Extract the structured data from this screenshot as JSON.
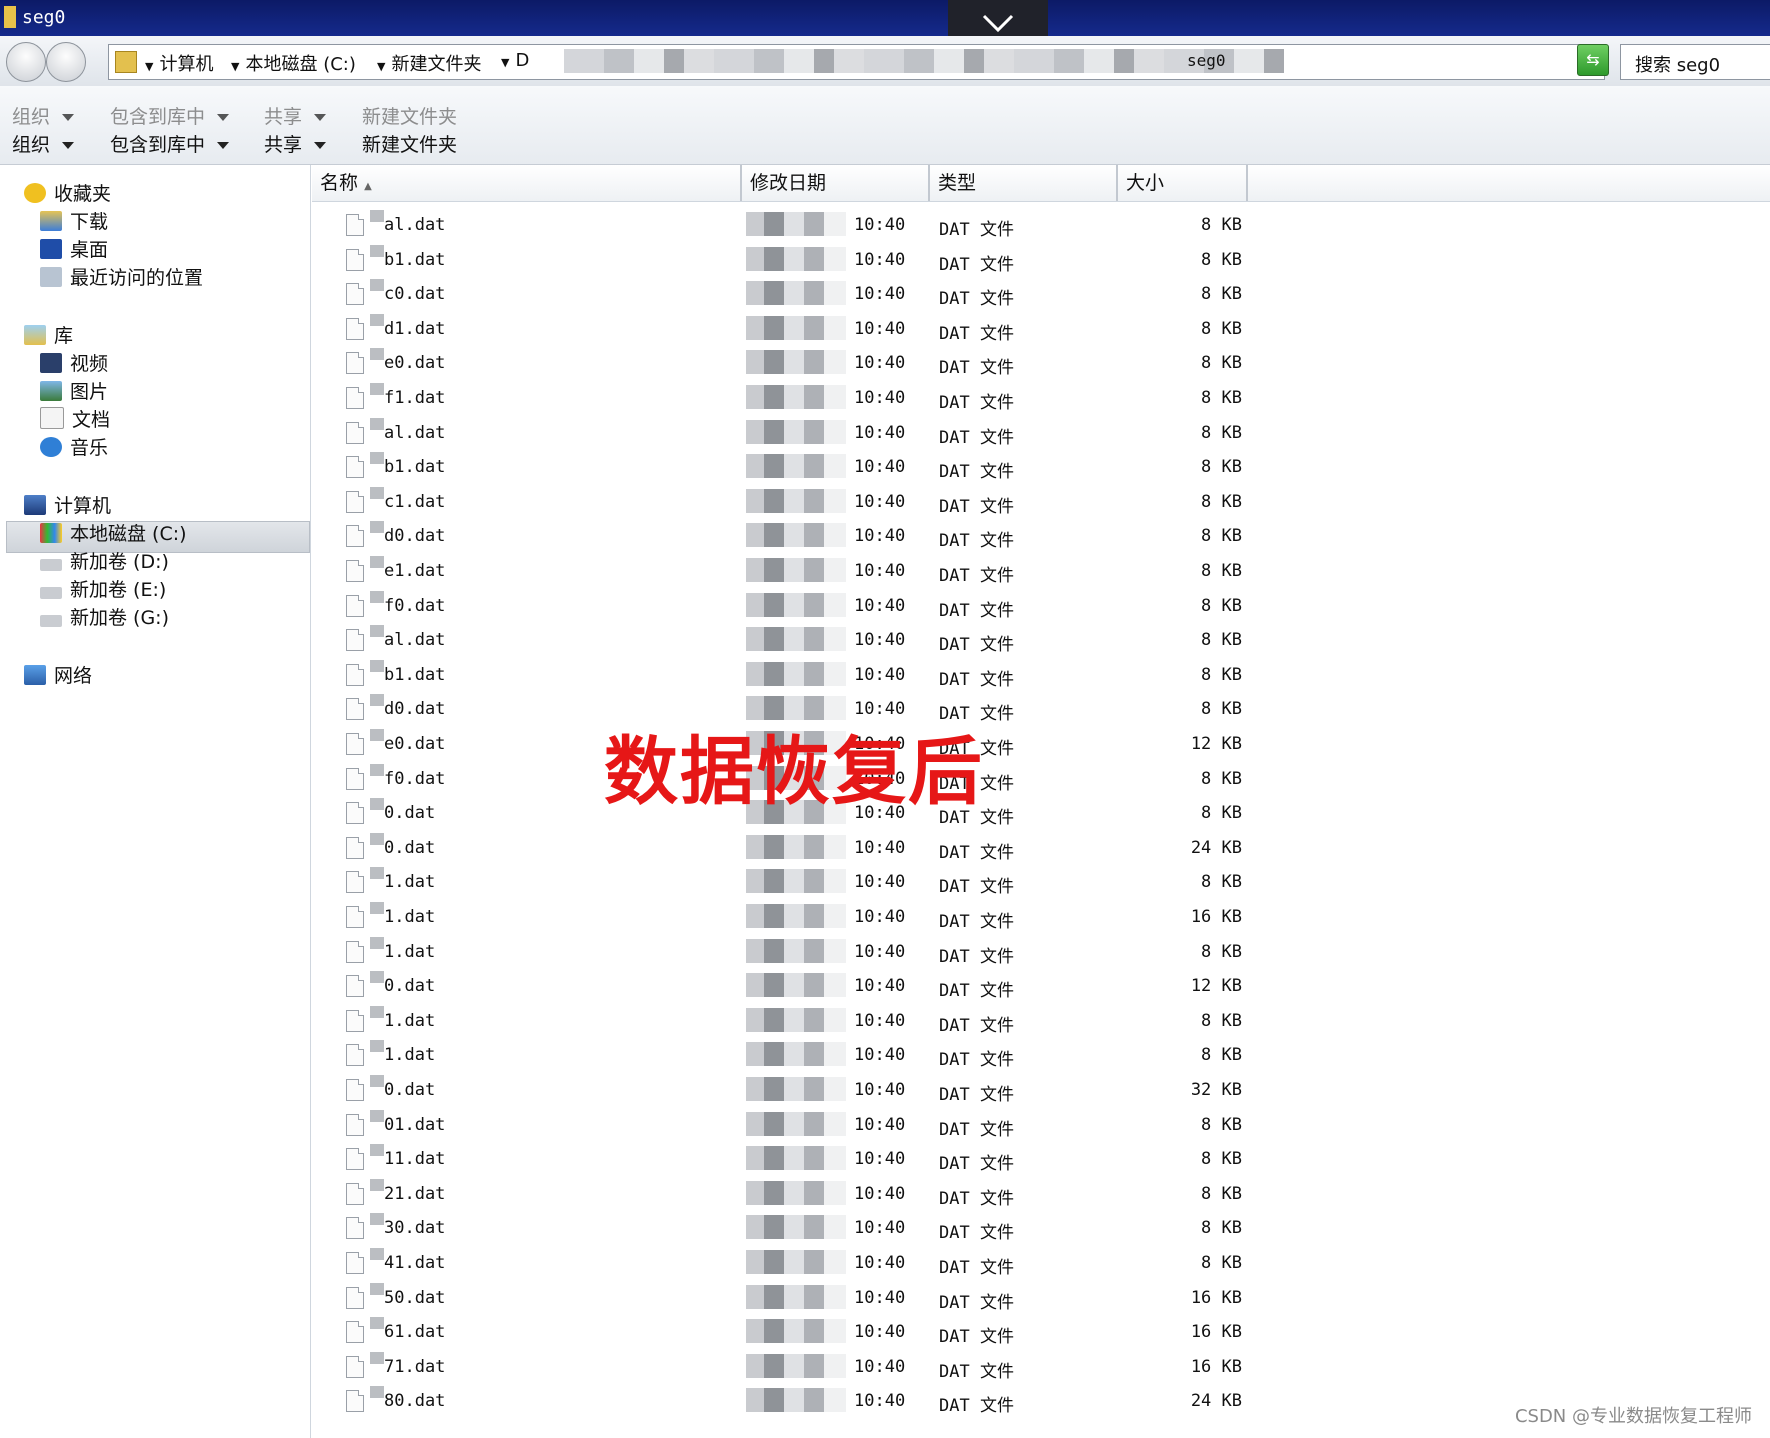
{
  "window": {
    "title": "seg0"
  },
  "address": {
    "crumbs": [
      "计算机",
      "本地磁盘 (C:)",
      "新建文件夹",
      "D"
    ],
    "tail": "seg0"
  },
  "search": {
    "placeholder": "搜索 seg0"
  },
  "toolbar": {
    "organize": "组织",
    "include_in_library": "包含到库中",
    "share": "共享",
    "new_folder": "新建文件夹"
  },
  "nav": {
    "favorites": "收藏夹",
    "downloads": "下载",
    "desktop": "桌面",
    "recent": "最近访问的位置",
    "libraries": "库",
    "videos": "视频",
    "pictures": "图片",
    "documents": "文档",
    "music": "音乐",
    "computer": "计算机",
    "local_c": "本地磁盘 (C:)",
    "vol_d": "新加卷 (D:)",
    "vol_e": "新加卷 (E:)",
    "vol_g": "新加卷 (G:)",
    "network": "网络"
  },
  "columns": {
    "name": "名称",
    "date": "修改日期",
    "type": "类型",
    "size": "大小"
  },
  "files": [
    {
      "name": "al.dat",
      "time": "10:40",
      "type": "DAT 文件",
      "size": "8 KB"
    },
    {
      "name": "b1.dat",
      "time": "10:40",
      "type": "DAT 文件",
      "size": "8 KB"
    },
    {
      "name": "c0.dat",
      "time": "10:40",
      "type": "DAT 文件",
      "size": "8 KB"
    },
    {
      "name": "d1.dat",
      "time": "10:40",
      "type": "DAT 文件",
      "size": "8 KB"
    },
    {
      "name": "e0.dat",
      "time": "10:40",
      "type": "DAT 文件",
      "size": "8 KB"
    },
    {
      "name": "f1.dat",
      "time": "10:40",
      "type": "DAT 文件",
      "size": "8 KB"
    },
    {
      "name": "al.dat",
      "time": "10:40",
      "type": "DAT 文件",
      "size": "8 KB"
    },
    {
      "name": "b1.dat",
      "time": "10:40",
      "type": "DAT 文件",
      "size": "8 KB"
    },
    {
      "name": "c1.dat",
      "time": "10:40",
      "type": "DAT 文件",
      "size": "8 KB"
    },
    {
      "name": "d0.dat",
      "time": "10:40",
      "type": "DAT 文件",
      "size": "8 KB"
    },
    {
      "name": "e1.dat",
      "time": "10:40",
      "type": "DAT 文件",
      "size": "8 KB"
    },
    {
      "name": "f0.dat",
      "time": "10:40",
      "type": "DAT 文件",
      "size": "8 KB"
    },
    {
      "name": "al.dat",
      "time": "10:40",
      "type": "DAT 文件",
      "size": "8 KB"
    },
    {
      "name": "b1.dat",
      "time": "10:40",
      "type": "DAT 文件",
      "size": "8 KB"
    },
    {
      "name": "d0.dat",
      "time": "10:40",
      "type": "DAT 文件",
      "size": "8 KB"
    },
    {
      "name": "e0.dat",
      "time": "10:40",
      "type": "DAT 文件",
      "size": "12 KB"
    },
    {
      "name": "f0.dat",
      "time": "10:40",
      "type": "DAT 文件",
      "size": "8 KB"
    },
    {
      "name": "0.dat",
      "time": "10:40",
      "type": "DAT 文件",
      "size": "8 KB"
    },
    {
      "name": "0.dat",
      "time": "10:40",
      "type": "DAT 文件",
      "size": "24 KB"
    },
    {
      "name": "1.dat",
      "time": "10:40",
      "type": "DAT 文件",
      "size": "8 KB"
    },
    {
      "name": "1.dat",
      "time": "10:40",
      "type": "DAT 文件",
      "size": "16 KB"
    },
    {
      "name": "1.dat",
      "time": "10:40",
      "type": "DAT 文件",
      "size": "8 KB"
    },
    {
      "name": "0.dat",
      "time": "10:40",
      "type": "DAT 文件",
      "size": "12 KB"
    },
    {
      "name": "1.dat",
      "time": "10:40",
      "type": "DAT 文件",
      "size": "8 KB"
    },
    {
      "name": "1.dat",
      "time": "10:40",
      "type": "DAT 文件",
      "size": "8 KB"
    },
    {
      "name": "0.dat",
      "time": "10:40",
      "type": "DAT 文件",
      "size": "32 KB"
    },
    {
      "name": "01.dat",
      "time": "10:40",
      "type": "DAT 文件",
      "size": "8 KB"
    },
    {
      "name": "11.dat",
      "time": "10:40",
      "type": "DAT 文件",
      "size": "8 KB"
    },
    {
      "name": "21.dat",
      "time": "10:40",
      "type": "DAT 文件",
      "size": "8 KB"
    },
    {
      "name": "30.dat",
      "time": "10:40",
      "type": "DAT 文件",
      "size": "8 KB"
    },
    {
      "name": "41.dat",
      "time": "10:40",
      "type": "DAT 文件",
      "size": "8 KB"
    },
    {
      "name": "50.dat",
      "time": "10:40",
      "type": "DAT 文件",
      "size": "16 KB"
    },
    {
      "name": "61.dat",
      "time": "10:40",
      "type": "DAT 文件",
      "size": "16 KB"
    },
    {
      "name": "71.dat",
      "time": "10:40",
      "type": "DAT 文件",
      "size": "16 KB"
    },
    {
      "name": "80.dat",
      "time": "10:40",
      "type": "DAT 文件",
      "size": "24 KB"
    }
  ],
  "annotation": "数据恢复后",
  "watermark": "CSDN @专业数据恢复工程师"
}
